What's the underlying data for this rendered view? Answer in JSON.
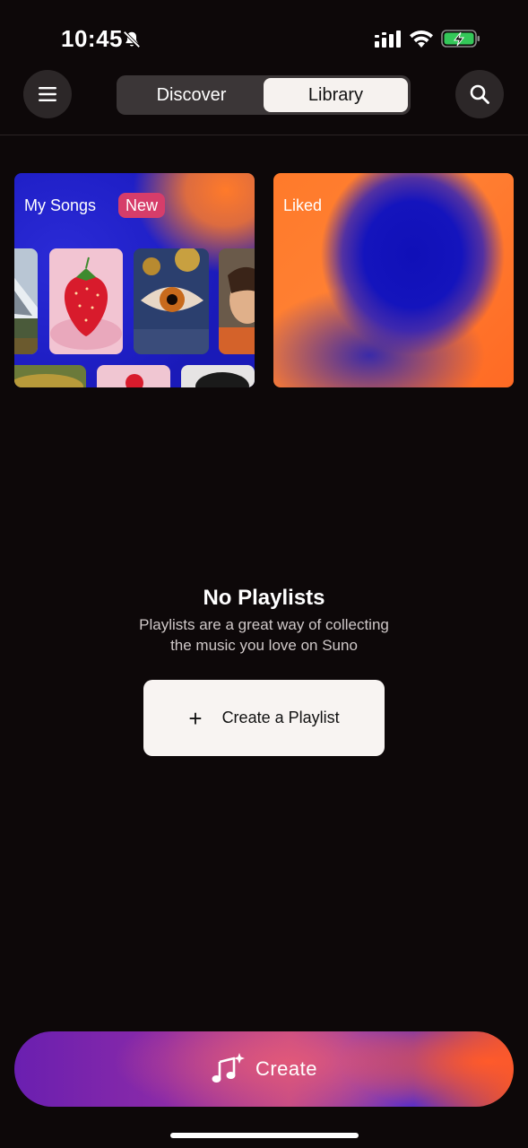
{
  "status_bar": {
    "time": "10:45",
    "bell_icon": "bell-slash-icon",
    "signal_icon": "cellular-signal-icon",
    "wifi_icon": "wifi-icon",
    "battery_icon": "battery-charging-icon"
  },
  "header": {
    "menu_icon": "hamburger-menu-icon",
    "search_icon": "search-icon",
    "tabs": [
      {
        "label": "Discover",
        "active": false
      },
      {
        "label": "Library",
        "active": true
      }
    ]
  },
  "library_cards": {
    "my_songs": {
      "title": "My Songs",
      "badge": "New"
    },
    "liked": {
      "title": "Liked"
    }
  },
  "empty_state": {
    "title": "No Playlists",
    "line1": "Playlists are a great way of collecting",
    "line2": "the music you love on Suno",
    "button_label": "Create a Playlist",
    "button_icon": "plus-icon"
  },
  "create_bar": {
    "label": "Create",
    "icon": "music-sparkle-icon"
  },
  "colors": {
    "background": "#0d0809",
    "accent_badge": "#d63d6a",
    "card_blue": "#1a1ab8",
    "card_orange": "#ff7a2a"
  }
}
